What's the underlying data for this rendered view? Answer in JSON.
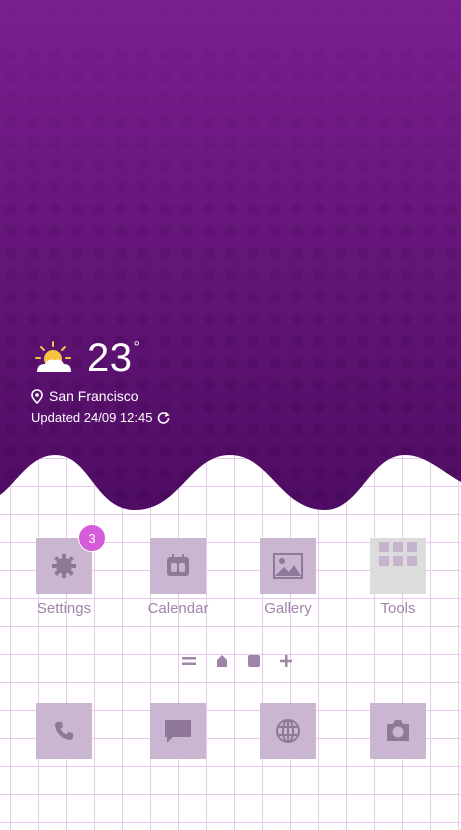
{
  "weather": {
    "temperature": "23",
    "unit": "°",
    "location": "San Francisco",
    "updated": "Updated 24/09 12:45",
    "icon": "partly-sunny-icon"
  },
  "apps": [
    {
      "label": "Settings",
      "icon": "gear-icon",
      "badge": "3"
    },
    {
      "label": "Calendar",
      "icon": "calendar-icon"
    },
    {
      "label": "Gallery",
      "icon": "image-icon"
    },
    {
      "label": "Tools",
      "icon": "folder-grid-icon"
    }
  ],
  "dock": [
    {
      "icon": "phone-icon"
    },
    {
      "icon": "message-icon"
    },
    {
      "icon": "globe-icon"
    },
    {
      "icon": "camera-icon"
    }
  ],
  "colors": {
    "wallpaper_top": "#7a1f8f",
    "wallpaper_bottom": "#4f0c63",
    "tile": "#cbb6d1",
    "label": "#9e84a8",
    "badge": "#d65bd9",
    "grid_line": "#e7c9ec"
  }
}
